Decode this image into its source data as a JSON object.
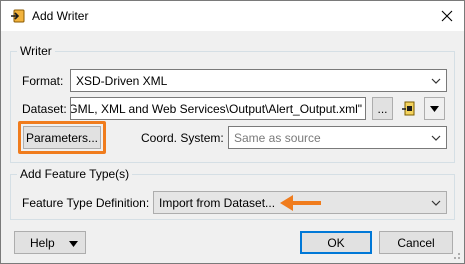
{
  "window": {
    "title": "Add Writer",
    "icon": "writer-icon",
    "close_icon": "close-icon"
  },
  "writer_group": {
    "legend": "Writer",
    "format_label": "Format:",
    "format_value": "XSD-Driven XML",
    "dataset_label": "Dataset:",
    "dataset_value": "GML, XML and Web Services\\Output\\Alert_Output.xml\"",
    "browse_label": "...",
    "parameters_label": "Parameters...",
    "coord_label": "Coord. System:",
    "coord_value": "Same as source"
  },
  "feature_group": {
    "legend": "Add Feature Type(s)",
    "definition_label": "Feature Type Definition:",
    "definition_value": "Import from Dataset..."
  },
  "footer": {
    "help_label": "Help",
    "ok_label": "OK",
    "cancel_label": "Cancel"
  },
  "colors": {
    "highlight": "#f07c1d",
    "accent": "#0078d7"
  }
}
